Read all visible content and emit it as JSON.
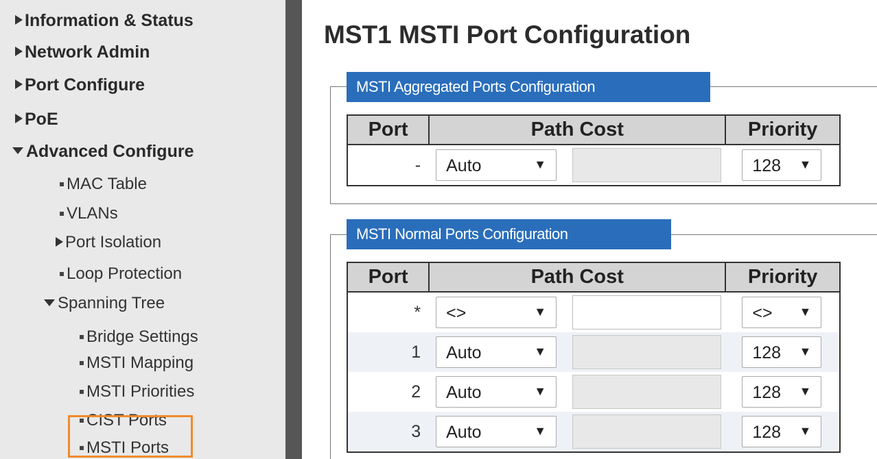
{
  "sidebar": {
    "items": [
      {
        "label": "Information & Status",
        "marker": "triangle-right"
      },
      {
        "label": "Network Admin",
        "marker": "triangle-right"
      },
      {
        "label": "Port Configure",
        "marker": "triangle-right"
      },
      {
        "label": "PoE",
        "marker": "triangle-right"
      },
      {
        "label": "Advanced Configure",
        "marker": "triangle-down"
      }
    ],
    "advanced_children": [
      {
        "label": "MAC Table",
        "marker": "bullet"
      },
      {
        "label": "VLANs",
        "marker": "bullet"
      },
      {
        "label": "Port Isolation",
        "marker": "triangle-right"
      },
      {
        "label": "Loop Protection",
        "marker": "bullet"
      },
      {
        "label": "Spanning Tree",
        "marker": "triangle-down"
      }
    ],
    "spanning_tree_children": [
      {
        "label": "Bridge Settings"
      },
      {
        "label": "MSTI Mapping"
      },
      {
        "label": "MSTI Priorities"
      },
      {
        "label": "CIST Ports"
      },
      {
        "label": "MSTI Ports",
        "selected": true
      }
    ],
    "highlight_color": "#f08a2c"
  },
  "main": {
    "title": "MST1 MSTI Port Configuration",
    "aggregated": {
      "legend": "MSTI Aggregated Ports Configuration",
      "headers": {
        "port": "Port",
        "path_cost": "Path Cost",
        "priority": "Priority"
      },
      "rows": [
        {
          "port": "-",
          "path_cost_mode": "Auto",
          "path_cost_value": "",
          "priority": "128"
        }
      ]
    },
    "normal": {
      "legend": "MSTI Normal Ports Configuration",
      "headers": {
        "port": "Port",
        "path_cost": "Path Cost",
        "priority": "Priority"
      },
      "rows": [
        {
          "port": "*",
          "path_cost_mode": "<>",
          "path_cost_value": "",
          "priority": "<>"
        },
        {
          "port": "1",
          "path_cost_mode": "Auto",
          "path_cost_value": "",
          "priority": "128"
        },
        {
          "port": "2",
          "path_cost_mode": "Auto",
          "path_cost_value": "",
          "priority": "128"
        },
        {
          "port": "3",
          "path_cost_mode": "Auto",
          "path_cost_value": "",
          "priority": "128"
        }
      ]
    },
    "dropdown_arrow": "▼",
    "legend_color": "#2a6ebb"
  }
}
